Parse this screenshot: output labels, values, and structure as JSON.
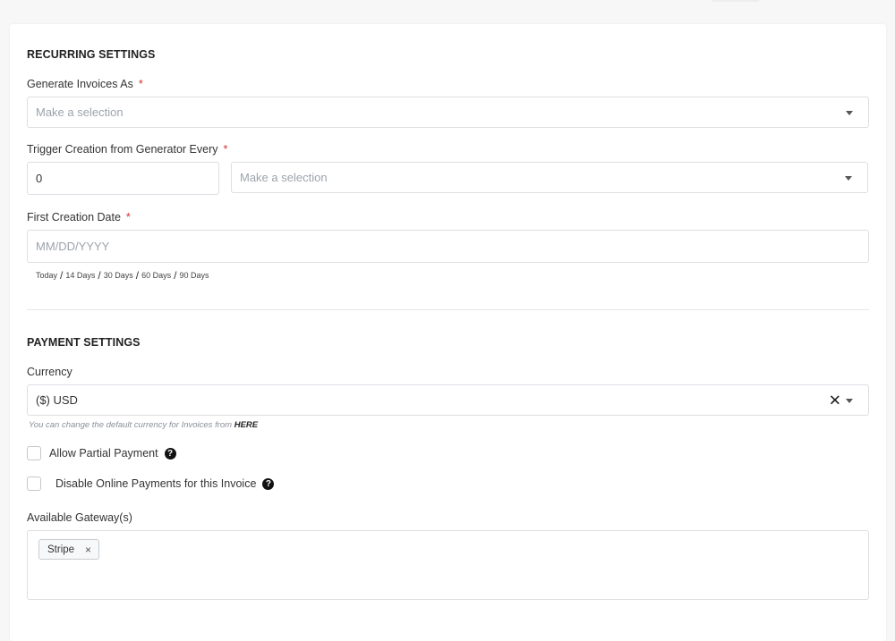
{
  "recurring": {
    "title": "RECURRING SETTINGS",
    "generate_label": "Generate Invoices As",
    "generate_placeholder": "Make a selection",
    "trigger_label": "Trigger Creation from Generator Every",
    "trigger_value": "0",
    "trigger_unit_placeholder": "Make a selection",
    "first_date_label": "First Creation Date",
    "first_date_placeholder": "MM/DD/YYYY",
    "required_mark": "*",
    "quick_dates": [
      "Today",
      "14 Days",
      "30 Days",
      "60 Days",
      "90 Days"
    ],
    "quick_date_separator": "/"
  },
  "payment": {
    "title": "PAYMENT SETTINGS",
    "currency_label": "Currency",
    "currency_value": "($) USD",
    "clear_symbol": "✕",
    "hint_text": "You can change the default currency for Invoices from",
    "hint_link": "HERE",
    "allow_partial_label": "Allow Partial Payment",
    "disable_online_label": "Disable Online Payments for this Invoice",
    "help_symbol": "?",
    "gateways_label": "Available Gateway(s)",
    "gateways": [
      {
        "name": "Stripe",
        "remove_symbol": "×"
      }
    ]
  },
  "colors": {
    "required": "#d62f2f",
    "border": "#dcdfe3",
    "placeholder": "#9da3ab"
  }
}
